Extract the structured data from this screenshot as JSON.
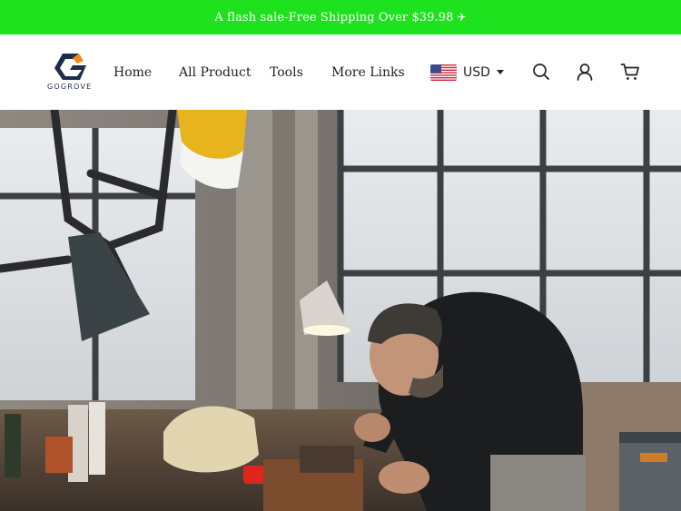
{
  "promo_bar": {
    "text": "A flash sale-Free Shipping Over $39.98",
    "icon": "paper-plane-icon"
  },
  "brand": {
    "name": "GOGROVE",
    "logo_icon": "gogrove-logo-icon"
  },
  "nav": {
    "items": [
      "Home",
      "All Product",
      "Tools",
      "More Links"
    ]
  },
  "currency": {
    "code": "USD",
    "flag_icon": "us-flag-icon",
    "dropdown_icon": "caret-down-icon"
  },
  "header_icons": {
    "search": "search-icon",
    "account": "user-icon",
    "cart": "cart-icon"
  },
  "hero": {
    "alt": "Man working with tools in a workshop"
  },
  "colors": {
    "promo_bg": "#1ee21e",
    "promo_text": "#ffffff",
    "brand_navy": "#1c2d4d",
    "accent_orange": "#f28a1c"
  }
}
